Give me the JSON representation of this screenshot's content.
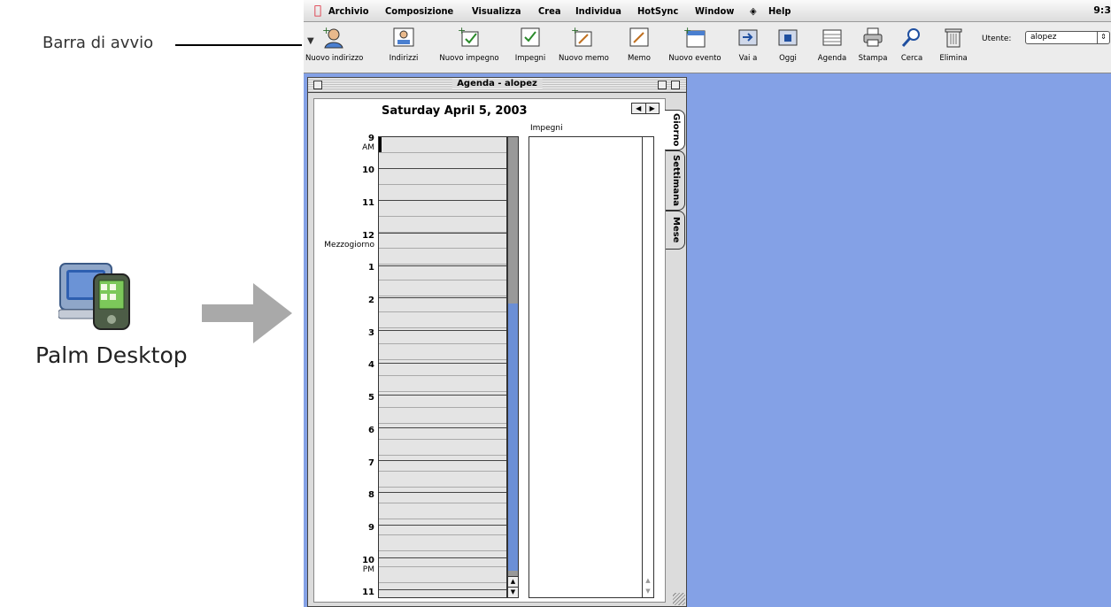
{
  "callout": {
    "label": "Barra di avvio"
  },
  "app": {
    "name": "Palm Desktop",
    "icon": "palm-desktop-app-icon"
  },
  "menubar": {
    "items": [
      "Archivio",
      "Composizione",
      "Visualizza",
      "Crea",
      "Individua",
      "HotSync",
      "Window",
      "Help"
    ],
    "clock": "9:3"
  },
  "toolbar": {
    "tools": [
      {
        "label": "Nuovo indirizzo",
        "icon": "new-address-icon"
      },
      {
        "label": "Indirizzi",
        "icon": "addresses-icon"
      },
      {
        "label": "Nuovo impegno",
        "icon": "new-task-icon"
      },
      {
        "label": "Impegni",
        "icon": "tasks-icon"
      },
      {
        "label": "Nuovo memo",
        "icon": "new-memo-icon"
      },
      {
        "label": "Memo",
        "icon": "memo-icon"
      },
      {
        "label": "Nuovo evento",
        "icon": "new-event-icon"
      },
      {
        "label": "Vai a",
        "icon": "goto-icon"
      },
      {
        "label": "Oggi",
        "icon": "today-icon"
      },
      {
        "label": "Agenda",
        "icon": "agenda-icon"
      },
      {
        "label": "Stampa",
        "icon": "printer-icon"
      },
      {
        "label": "Cerca",
        "icon": "search-icon"
      },
      {
        "label": "Elimina",
        "icon": "trash-icon"
      }
    ],
    "user_label": "Utente:",
    "user_value": "alopez"
  },
  "window": {
    "title": "Agenda - alopez",
    "date": "Saturday April 5, 2003",
    "tasks_header": "Impegni",
    "hours": [
      {
        "h": "9",
        "sub": "AM"
      },
      {
        "h": "10",
        "sub": ""
      },
      {
        "h": "11",
        "sub": ""
      },
      {
        "h": "12",
        "sub": "Mezzogiorno"
      },
      {
        "h": "1",
        "sub": ""
      },
      {
        "h": "2",
        "sub": ""
      },
      {
        "h": "3",
        "sub": ""
      },
      {
        "h": "4",
        "sub": ""
      },
      {
        "h": "5",
        "sub": ""
      },
      {
        "h": "6",
        "sub": ""
      },
      {
        "h": "7",
        "sub": ""
      },
      {
        "h": "8",
        "sub": ""
      },
      {
        "h": "9",
        "sub": ""
      },
      {
        "h": "10",
        "sub": "PM"
      },
      {
        "h": "11",
        "sub": ""
      }
    ],
    "tabs": [
      "Giorno",
      "Settimana",
      "Mese"
    ],
    "active_tab": "Giorno"
  },
  "colors": {
    "desktop": "#84a1e6",
    "scroll_thumb": "#6b8fd6",
    "arrow": "#a9a9a9"
  }
}
